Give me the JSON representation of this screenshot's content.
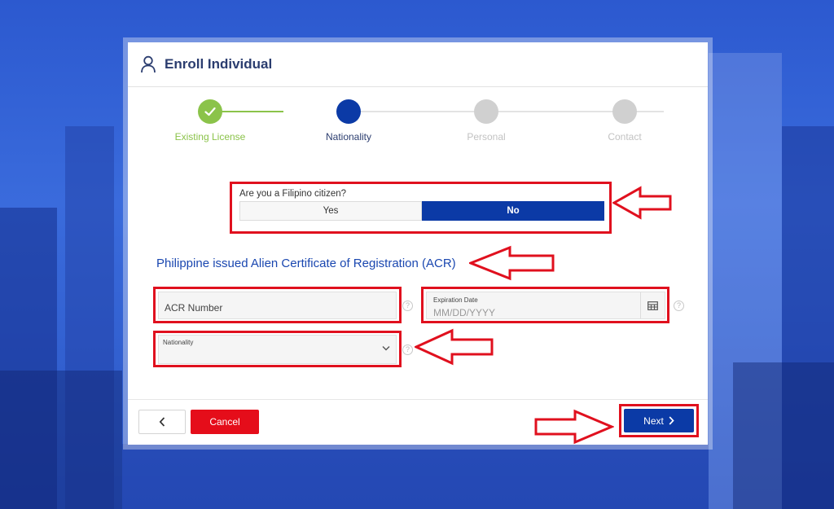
{
  "header": {
    "title": "Enroll Individual",
    "icon": "user-icon"
  },
  "stepper": {
    "steps": [
      {
        "label": "Existing License",
        "state": "completed"
      },
      {
        "label": "Nationality",
        "state": "active"
      },
      {
        "label": "Personal",
        "state": "pending"
      },
      {
        "label": "Contact",
        "state": "pending"
      }
    ]
  },
  "citizen": {
    "question": "Are you a Filipino citizen?",
    "options": [
      "Yes",
      "No"
    ],
    "selected": "No"
  },
  "acr": {
    "heading": "Philippine issued Alien Certificate of Registration (ACR)",
    "number_placeholder": "ACR Number",
    "expiration_label": "Expiration Date",
    "expiration_placeholder": "MM/DD/YYYY",
    "nationality_label": "Nationality",
    "help_glyph": "?"
  },
  "footer": {
    "back_icon": "chevron-left-icon",
    "cancel_label": "Cancel",
    "next_label": "Next"
  },
  "colors": {
    "primary": "#0b3aa6",
    "success": "#8bc34a",
    "danger": "#e50d1a",
    "annotation": "#e0101e"
  }
}
